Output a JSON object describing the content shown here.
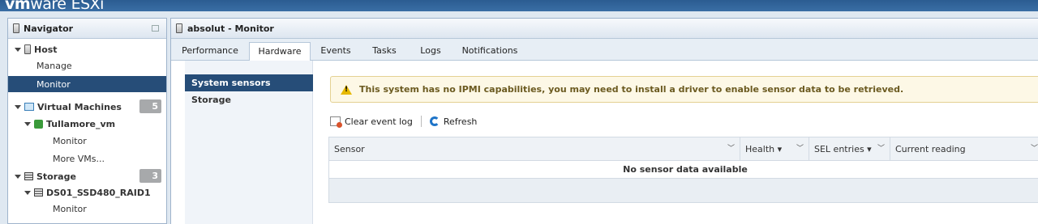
{
  "brand": {
    "vm": "vm",
    "ware": "ware",
    "product": "ESXi"
  },
  "navigator": {
    "title": "Navigator",
    "host": {
      "label": "Host",
      "children": [
        "Manage",
        "Monitor"
      ]
    },
    "vms": {
      "label": "Virtual Machines",
      "count": "5",
      "vm_name": "Tullamore_vm",
      "vm_children": [
        "Monitor",
        "More VMs..."
      ]
    },
    "storage": {
      "label": "Storage",
      "count": "3",
      "ds_name": "DS01_SSD480_RAID1",
      "ds_children": [
        "Monitor"
      ]
    }
  },
  "main": {
    "title": "absolut - Monitor",
    "tabs": [
      "Performance",
      "Hardware",
      "Events",
      "Tasks",
      "Logs",
      "Notifications"
    ],
    "active_tab": "Hardware",
    "side_items": [
      "System sensors",
      "Storage"
    ],
    "alert": "This system has no IPMI capabilities, you may need to install a driver to enable sensor data to be retrieved.",
    "toolbar": {
      "clear": "Clear event log",
      "refresh": "Refresh"
    },
    "grid": {
      "columns": [
        "Sensor",
        "Health ▾",
        "SEL entries ▾",
        "Current reading"
      ],
      "empty": "No sensor data available"
    }
  }
}
